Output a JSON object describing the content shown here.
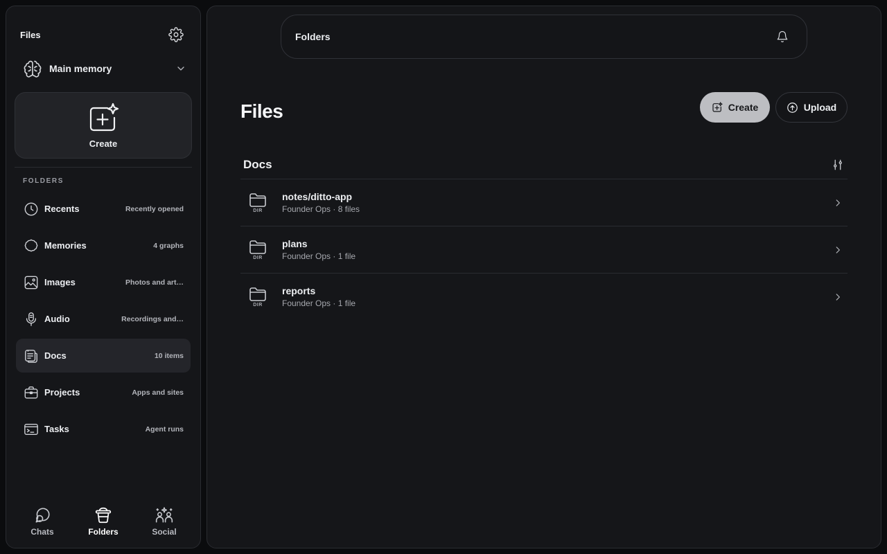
{
  "sidebar": {
    "title": "Files",
    "memory_label": "Main memory",
    "create_label": "Create",
    "section_label": "FOLDERS",
    "items": [
      {
        "label": "Recents",
        "sub": "Recently opened"
      },
      {
        "label": "Memories",
        "sub": "4 graphs"
      },
      {
        "label": "Images",
        "sub": "Photos and art…"
      },
      {
        "label": "Audio",
        "sub": "Recordings and…"
      },
      {
        "label": "Docs",
        "sub": "10 items"
      },
      {
        "label": "Projects",
        "sub": "Apps and sites"
      },
      {
        "label": "Tasks",
        "sub": "Agent runs"
      }
    ],
    "bottom_nav": [
      {
        "label": "Chats"
      },
      {
        "label": "Folders"
      },
      {
        "label": "Social"
      }
    ]
  },
  "topbar": {
    "title": "Folders"
  },
  "main": {
    "title": "Files",
    "create_label": "Create",
    "upload_label": "Upload",
    "section_title": "Docs",
    "rows": [
      {
        "name": "notes/ditto-app",
        "meta": "Founder Ops · 8 files",
        "badge": "DIR"
      },
      {
        "name": "plans",
        "meta": "Founder Ops · 1 file",
        "badge": "DIR"
      },
      {
        "name": "reports",
        "meta": "Founder Ops · 1 file",
        "badge": "DIR"
      }
    ]
  },
  "colors": {
    "background": "#0b0c0e",
    "panel": "#151619",
    "active_item": "#24252a",
    "create_button": "#bdbec2"
  }
}
